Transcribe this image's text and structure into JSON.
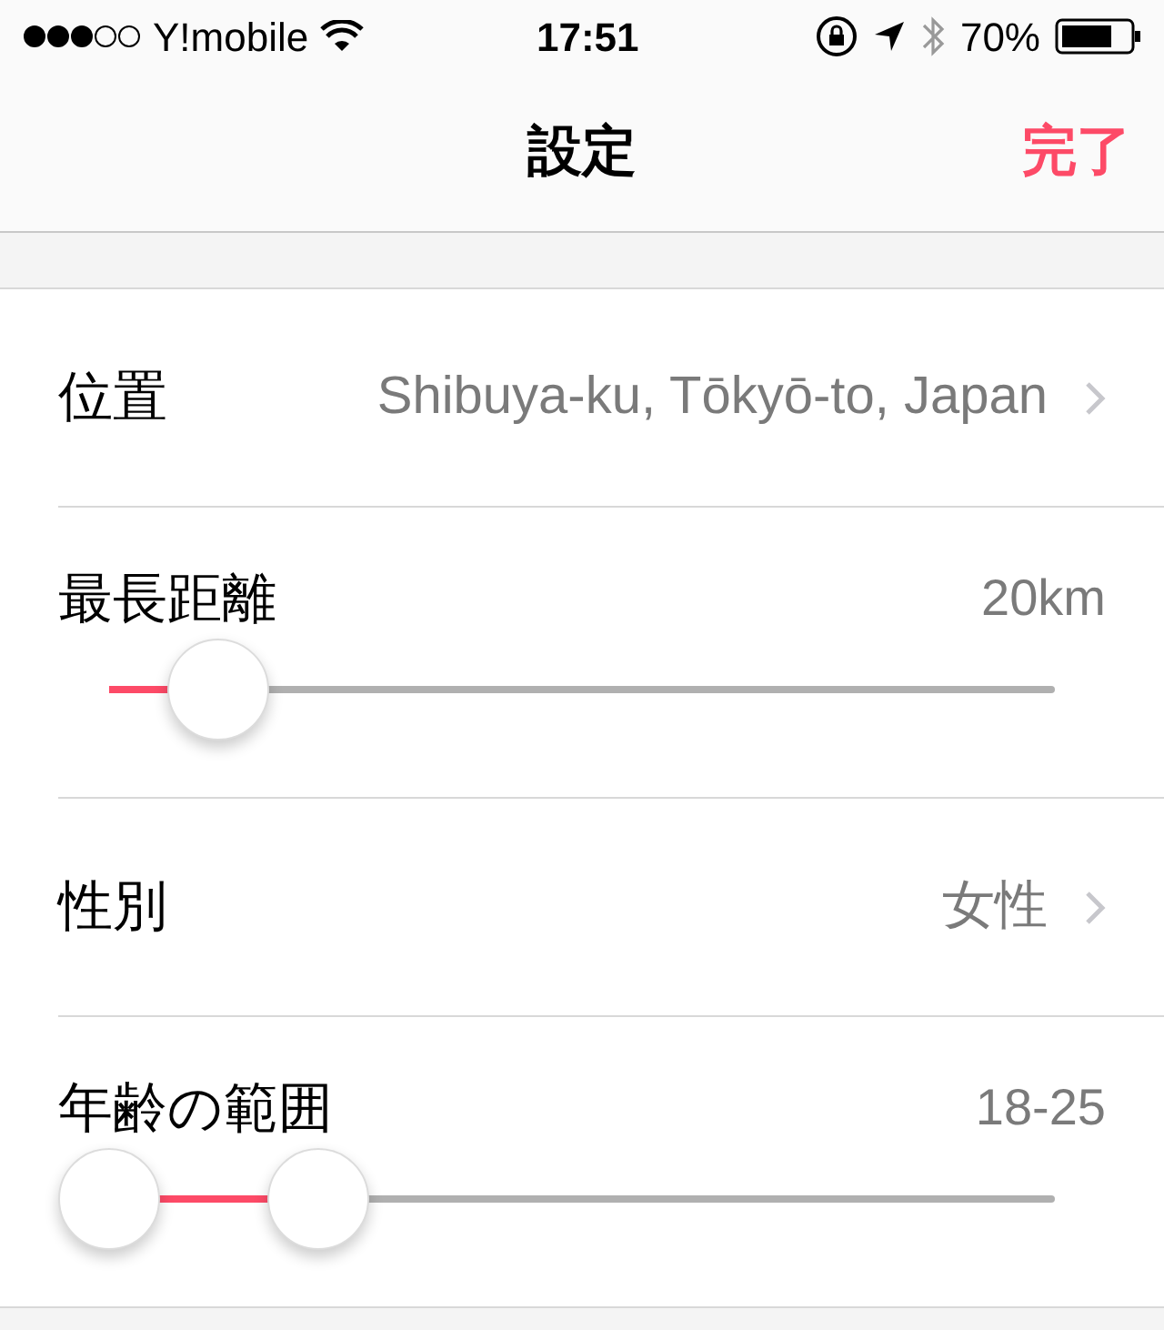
{
  "status_bar": {
    "carrier": "Y!mobile",
    "time": "17:51",
    "battery": "70%"
  },
  "nav": {
    "title": "設定",
    "done": "完了"
  },
  "rows": [
    {
      "kind": "link",
      "label": "位置",
      "value": "Shibuya-ku, Tōkyō-to, Japan"
    },
    {
      "kind": "slider",
      "label": "最長距離",
      "value": "20km",
      "thumbs": [
        {
          "level": 0.115
        }
      ]
    },
    {
      "kind": "link",
      "label": "性別",
      "value": "女性"
    },
    {
      "kind": "range",
      "label": "年齢の範囲",
      "value": "18-25",
      "thumbs": [
        {
          "level": 0
        },
        {
          "level": 0.222
        }
      ]
    }
  ]
}
